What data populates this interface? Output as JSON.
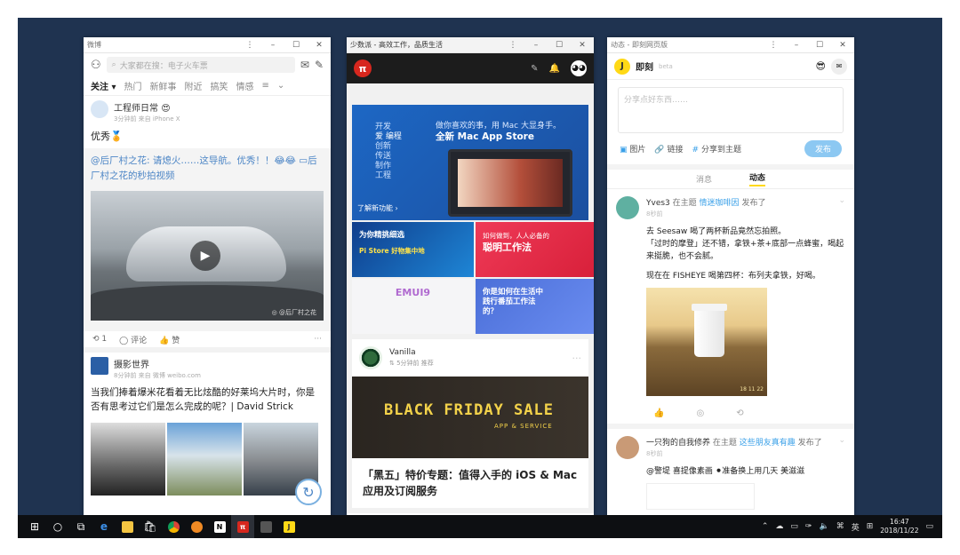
{
  "weibo": {
    "window_title": "微博",
    "search_placeholder": "大家都在搜：电子火车票",
    "tabs": [
      "关注 ▾",
      "热门",
      "新鲜事",
      "附近",
      "搞笑",
      "情感",
      "≡"
    ],
    "post1": {
      "author": "工程师日常",
      "badge": "😍",
      "meta": "3分钟前 来自 iPhone X",
      "text": "优秀🏅",
      "repost_text": "@后厂村之花: 请熄火……这导航。优秀！！😂😂 ▭后厂村之花的秒拍视频",
      "video_watermark": "◎ @后厂村之花",
      "repost_count": "1",
      "comment_label": "评论",
      "like_label": "赞"
    },
    "post2": {
      "author": "摄影世界",
      "meta": "8分钟前 来自 微博 weibo.com",
      "text": "当我们捧着爆米花看着无比炫酷的好莱坞大片时，你是否有思考过它们是怎么完成的呢？| David Strick"
    }
  },
  "sspai": {
    "window_title": "少数派 - 高效工作，品质生活",
    "logo": "π",
    "banner": {
      "left_lines": [
        "开发",
        "爱 编程",
        "创新",
        "传送",
        "制作",
        "工程"
      ],
      "tagline": "做你喜欢的事，用 Mac 大显身手。",
      "headline": "全新 Mac App Store",
      "more": "了解新功能 ›"
    },
    "tiles": [
      {
        "title": "为你精挑细选",
        "sub": "Pi Store 好物集中地"
      },
      {
        "title": "聪明工作法",
        "sub": "如何做到，人人必备的"
      },
      {
        "title": "EMUI9",
        "sub": ""
      },
      {
        "title": "你是如何在生活中践行番茄工作法的？",
        "sub": ""
      }
    ],
    "card": {
      "author": "Vanilla",
      "meta": "⇅ 5分钟前 推荐"
    },
    "promo": {
      "title": "BLACK FRIDAY SALE",
      "sub": "APP & SERVICE"
    },
    "article_title": "「黑五」特价专题：值得入手的 iOS & Mac 应用及订阅服务"
  },
  "jike": {
    "window_title": "动态 - 即刻网页版",
    "brand": "即刻",
    "beta": "beta",
    "compose_placeholder": "分享点好东西……",
    "tools": {
      "image": "图片",
      "link": "链接",
      "topic": "分享到主题",
      "publish": "发布"
    },
    "tabs": [
      "消息",
      "动态"
    ],
    "post1": {
      "user": "Yves3",
      "in_topic": "在主题",
      "topic": "情迷咖啡因",
      "action": "发布了",
      "meta": "8秒前",
      "body1": "去 Seesaw 喝了两杯新品竟然忘拍照。",
      "body2": "「过时的摩登」还不错，拿铁+茶+底部一点蜂蜜，喝起来挺脆，也不会腻。",
      "body3": "现在在 FISHEYE 喝第四杯：布列夫拿铁，好喝。",
      "photo_stamp": "18 11 22"
    },
    "post2": {
      "user": "一只狗的自我修养",
      "in_topic": "在主题",
      "topic": "这些朋友真有趣",
      "action": "发布了",
      "meta": "8秒前",
      "body": "@警堤 喜提像素画 ⚫准备换上用几天 美滋滋"
    }
  },
  "taskbar": {
    "ime": "英",
    "time": "16:47",
    "date": "2018/11/22"
  }
}
